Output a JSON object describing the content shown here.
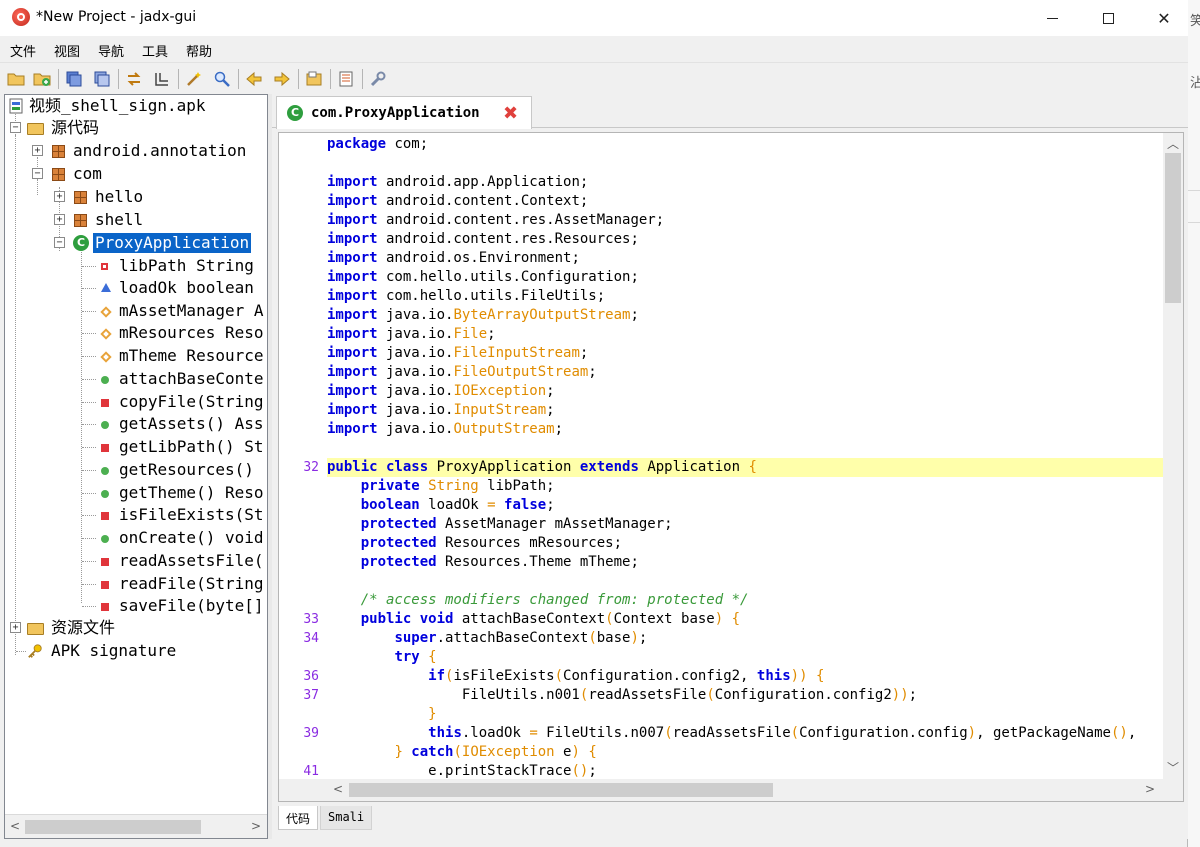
{
  "window": {
    "title": "*New Project - jadx-gui",
    "min_glyph": "—",
    "max_glyph": "☐",
    "close_glyph": "✕"
  },
  "menu": [
    "文件",
    "视图",
    "导航",
    "工具",
    "帮助"
  ],
  "toolbar_icons": [
    "open-file-icon",
    "add-file-icon",
    "save-icon",
    "save-all-icon",
    "sync-icon",
    "flatten-icon",
    "decompile-icon",
    "search-icon",
    "back-icon",
    "forward-icon",
    "log-icon",
    "settings-icon",
    "preferences-icon"
  ],
  "tree": {
    "root": "视频_shell_sign.apk",
    "source_folder": "源代码",
    "pkg_android": "android.annotation",
    "pkg_com": "com",
    "pkg_hello": "hello",
    "pkg_shell": "shell",
    "class_selected": "ProxyApplication",
    "members": [
      {
        "label": "libPath String",
        "kind": "field-private"
      },
      {
        "label": "loadOk boolean",
        "kind": "field-package"
      },
      {
        "label": "mAssetManager A",
        "kind": "field-protected"
      },
      {
        "label": "mResources Reso",
        "kind": "field-protected"
      },
      {
        "label": "mTheme Resource",
        "kind": "field-protected"
      },
      {
        "label": "attachBaseConte",
        "kind": "method-public"
      },
      {
        "label": "copyFile(String",
        "kind": "method-private"
      },
      {
        "label": "getAssets() Ass",
        "kind": "method-public"
      },
      {
        "label": "getLibPath() St",
        "kind": "method-private"
      },
      {
        "label": "getResources() ",
        "kind": "method-public"
      },
      {
        "label": "getTheme() Reso",
        "kind": "method-public"
      },
      {
        "label": "isFileExists(St",
        "kind": "method-private"
      },
      {
        "label": "onCreate() void",
        "kind": "method-public"
      },
      {
        "label": "readAssetsFile(",
        "kind": "method-private"
      },
      {
        "label": "readFile(String",
        "kind": "method-private"
      },
      {
        "label": "saveFile(byte[]",
        "kind": "method-private"
      }
    ],
    "resources_folder": "资源文件",
    "signature": "APK signature"
  },
  "editor": {
    "tab_title": "com.ProxyApplication",
    "class_icon_letter": "C",
    "close_glyph": "✖",
    "bottom_tabs": [
      "代码",
      "Smali"
    ],
    "lines": [
      {
        "ln": "",
        "hl": false,
        "tokens": [
          [
            "kw",
            "package"
          ],
          [
            "",
            "com;"
          ]
        ]
      },
      {
        "ln": "",
        "hl": false,
        "tokens": [
          [
            "",
            ""
          ]
        ]
      },
      {
        "ln": "",
        "hl": false,
        "tokens": [
          [
            "kw",
            "import"
          ],
          [
            "",
            "android.app.Application;"
          ]
        ]
      },
      {
        "ln": "",
        "hl": false,
        "tokens": [
          [
            "kw",
            "import"
          ],
          [
            "",
            "android.content.Context;"
          ]
        ]
      },
      {
        "ln": "",
        "hl": false,
        "tokens": [
          [
            "kw",
            "import"
          ],
          [
            "",
            "android.content.res.AssetManager;"
          ]
        ]
      },
      {
        "ln": "",
        "hl": false,
        "tokens": [
          [
            "kw",
            "import"
          ],
          [
            "",
            "android.content.res.Resources;"
          ]
        ]
      },
      {
        "ln": "",
        "hl": false,
        "tokens": [
          [
            "kw",
            "import"
          ],
          [
            "",
            "android.os.Environment;"
          ]
        ]
      },
      {
        "ln": "",
        "hl": false,
        "tokens": [
          [
            "kw",
            "import"
          ],
          [
            "",
            "com.hello.utils.Configuration;"
          ]
        ]
      },
      {
        "ln": "",
        "hl": false,
        "tokens": [
          [
            "kw",
            "import"
          ],
          [
            "",
            "com.hello.utils.FileUtils;"
          ]
        ]
      },
      {
        "ln": "",
        "hl": false,
        "tokens": [
          [
            "kw",
            "import"
          ],
          [
            "",
            "java.io."
          ],
          [
            "ty",
            "ByteArrayOutputStream"
          ],
          [
            "",
            ";"
          ]
        ]
      },
      {
        "ln": "",
        "hl": false,
        "tokens": [
          [
            "kw",
            "import"
          ],
          [
            "",
            "java.io."
          ],
          [
            "ty",
            "File"
          ],
          [
            "",
            ";"
          ]
        ]
      },
      {
        "ln": "",
        "hl": false,
        "tokens": [
          [
            "kw",
            "import"
          ],
          [
            "",
            "java.io."
          ],
          [
            "ty",
            "FileInputStream"
          ],
          [
            "",
            ";"
          ]
        ]
      },
      {
        "ln": "",
        "hl": false,
        "tokens": [
          [
            "kw",
            "import"
          ],
          [
            "",
            "java.io."
          ],
          [
            "ty",
            "FileOutputStream"
          ],
          [
            "",
            ";"
          ]
        ]
      },
      {
        "ln": "",
        "hl": false,
        "tokens": [
          [
            "kw",
            "import"
          ],
          [
            "",
            "java.io."
          ],
          [
            "ty",
            "IOException"
          ],
          [
            "",
            ";"
          ]
        ]
      },
      {
        "ln": "",
        "hl": false,
        "tokens": [
          [
            "kw",
            "import"
          ],
          [
            "",
            "java.io."
          ],
          [
            "ty",
            "InputStream"
          ],
          [
            "",
            ";"
          ]
        ]
      },
      {
        "ln": "",
        "hl": false,
        "tokens": [
          [
            "kw",
            "import"
          ],
          [
            "",
            "java.io."
          ],
          [
            "ty",
            "OutputStream"
          ],
          [
            "",
            ";"
          ]
        ]
      },
      {
        "ln": "",
        "hl": false,
        "tokens": [
          [
            "",
            ""
          ]
        ]
      },
      {
        "ln": "32",
        "hl": true,
        "tokens": [
          [
            "kw",
            "public class"
          ],
          [
            "",
            "ProxyApplication"
          ],
          [
            "kw",
            "extends"
          ],
          [
            "",
            "Application"
          ],
          [
            "ty",
            "{"
          ]
        ]
      },
      {
        "ln": "",
        "hl": false,
        "tokens": [
          [
            "",
            "    "
          ],
          [
            "kw",
            "private"
          ],
          [
            "ty",
            "String"
          ],
          [
            "",
            "libPath;"
          ]
        ]
      },
      {
        "ln": "",
        "hl": false,
        "tokens": [
          [
            "",
            "    "
          ],
          [
            "kw",
            "boolean"
          ],
          [
            "",
            "loadOk"
          ],
          [
            "ty",
            "="
          ],
          [
            "kw",
            "false"
          ],
          [
            "",
            ";"
          ]
        ]
      },
      {
        "ln": "",
        "hl": false,
        "tokens": [
          [
            "",
            "    "
          ],
          [
            "kw",
            "protected"
          ],
          [
            "",
            "AssetManager mAssetManager;"
          ]
        ]
      },
      {
        "ln": "",
        "hl": false,
        "tokens": [
          [
            "",
            "    "
          ],
          [
            "kw",
            "protected"
          ],
          [
            "",
            "Resources mResources;"
          ]
        ]
      },
      {
        "ln": "",
        "hl": false,
        "tokens": [
          [
            "",
            "    "
          ],
          [
            "kw",
            "protected"
          ],
          [
            "",
            "Resources.Theme mTheme;"
          ]
        ]
      },
      {
        "ln": "",
        "hl": false,
        "tokens": [
          [
            "",
            ""
          ]
        ]
      },
      {
        "ln": "",
        "hl": false,
        "tokens": [
          [
            "",
            "    "
          ],
          [
            "cm",
            "/* access modifiers changed from: protected */"
          ]
        ]
      },
      {
        "ln": "33",
        "hl": false,
        "tokens": [
          [
            "",
            "    "
          ],
          [
            "kw",
            "public void"
          ],
          [
            "",
            "attachBaseContext"
          ],
          [
            "ty",
            "("
          ],
          [
            "",
            "Context base"
          ],
          [
            "ty",
            ")"
          ],
          [
            "ty",
            "{"
          ]
        ]
      },
      {
        "ln": "34",
        "hl": false,
        "tokens": [
          [
            "",
            "        "
          ],
          [
            "kw",
            "super"
          ],
          [
            "",
            ".attachBaseContext"
          ],
          [
            "ty",
            "("
          ],
          [
            "",
            "base"
          ],
          [
            "ty",
            ")"
          ],
          [
            "",
            ";"
          ]
        ]
      },
      {
        "ln": "",
        "hl": false,
        "tokens": [
          [
            "",
            "        "
          ],
          [
            "kw",
            "try"
          ],
          [
            "ty",
            "{"
          ]
        ]
      },
      {
        "ln": "36",
        "hl": false,
        "tokens": [
          [
            "",
            "            "
          ],
          [
            "kw",
            "if"
          ],
          [
            "ty",
            "("
          ],
          [
            "",
            "isFileExists"
          ],
          [
            "ty",
            "("
          ],
          [
            "",
            "Configuration.config2,"
          ],
          [
            "kw",
            "this"
          ],
          [
            "ty",
            ")"
          ],
          [
            "ty",
            ")"
          ],
          [
            "ty",
            "{"
          ]
        ]
      },
      {
        "ln": "37",
        "hl": false,
        "tokens": [
          [
            "",
            "                "
          ],
          [
            "",
            "FileUtils.n001"
          ],
          [
            "ty",
            "("
          ],
          [
            "",
            "readAssetsFile"
          ],
          [
            "ty",
            "("
          ],
          [
            "",
            "Configuration.config2"
          ],
          [
            "ty",
            ")"
          ],
          [
            "ty",
            ")"
          ],
          [
            "",
            ";"
          ]
        ]
      },
      {
        "ln": "",
        "hl": false,
        "tokens": [
          [
            "",
            "            "
          ],
          [
            "ty",
            "}"
          ]
        ]
      },
      {
        "ln": "39",
        "hl": false,
        "tokens": [
          [
            "",
            "            "
          ],
          [
            "kw",
            "this"
          ],
          [
            "",
            ".loadOk"
          ],
          [
            "ty",
            "="
          ],
          [
            "",
            "FileUtils.n007"
          ],
          [
            "ty",
            "("
          ],
          [
            "",
            "readAssetsFile"
          ],
          [
            "ty",
            "("
          ],
          [
            "",
            "Configuration.config"
          ],
          [
            "ty",
            ")"
          ],
          [
            "",
            ", getPackageName"
          ],
          [
            "ty",
            "()"
          ],
          [
            "",
            ","
          ]
        ]
      },
      {
        "ln": "",
        "hl": false,
        "tokens": [
          [
            "",
            "        "
          ],
          [
            "ty",
            "}"
          ],
          [
            "kw",
            "catch"
          ],
          [
            "ty",
            "("
          ],
          [
            "ty",
            "IOException"
          ],
          [
            "",
            "e"
          ],
          [
            "ty",
            ")"
          ],
          [
            "ty",
            "{"
          ]
        ]
      },
      {
        "ln": "41",
        "hl": false,
        "tokens": [
          [
            "",
            "            "
          ],
          [
            "",
            "e.printStackTrace"
          ],
          [
            "ty",
            "()"
          ],
          [
            "",
            ";"
          ]
        ]
      }
    ]
  },
  "right_strip_chars": [
    "笑",
    "",
    "沾",
    ""
  ]
}
